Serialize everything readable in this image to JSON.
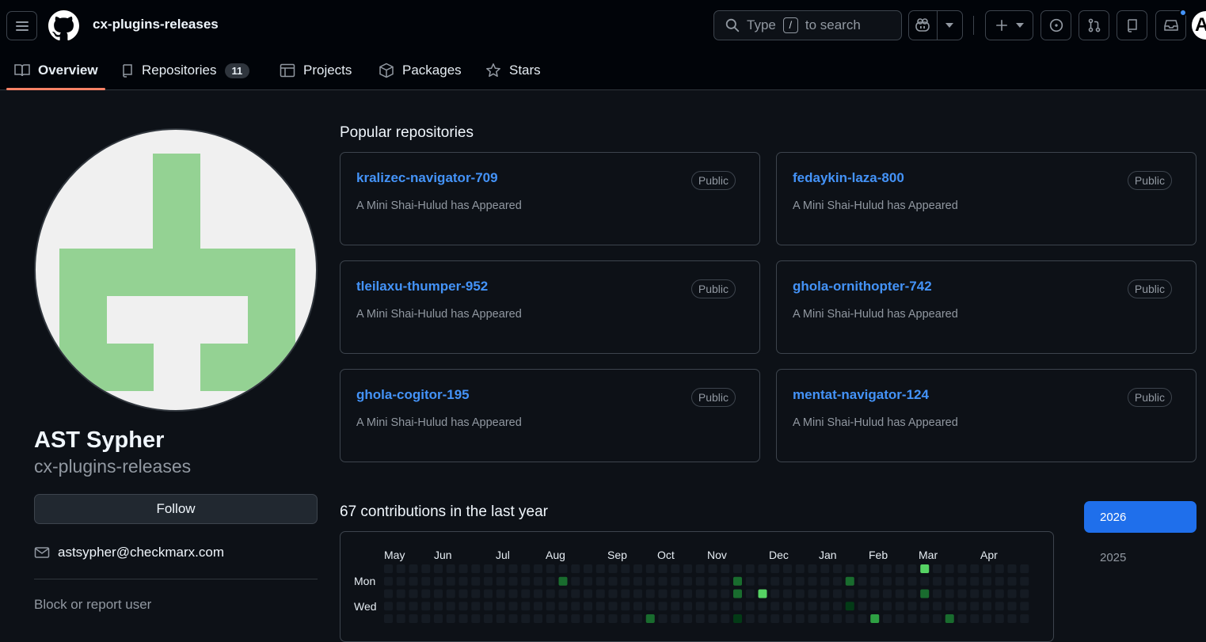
{
  "header": {
    "context_title": "cx-plugins-releases",
    "search": {
      "prefix": "Type",
      "key": "/",
      "suffix": "to search"
    },
    "avatar_letter": "A"
  },
  "tabs": [
    {
      "label": "Overview",
      "icon": "book-icon",
      "active": true
    },
    {
      "label": "Repositories",
      "icon": "repo-icon",
      "count": "11"
    },
    {
      "label": "Projects",
      "icon": "table-icon"
    },
    {
      "label": "Packages",
      "icon": "package-icon"
    },
    {
      "label": "Stars",
      "icon": "star-icon"
    }
  ],
  "profile": {
    "name": "AST Sypher",
    "login": "cx-plugins-releases",
    "follow_label": "Follow",
    "email": "astsypher@checkmarx.com",
    "block_label": "Block or report user",
    "avatar_color": "#94d293"
  },
  "popular": {
    "title": "Popular repositories",
    "repos": [
      {
        "name": "kralizec-navigator-709",
        "visibility": "Public",
        "description": "A Mini Shai-Hulud has Appeared"
      },
      {
        "name": "fedaykin-laza-800",
        "visibility": "Public",
        "description": "A Mini Shai-Hulud has Appeared"
      },
      {
        "name": "tleilaxu-thumper-952",
        "visibility": "Public",
        "description": "A Mini Shai-Hulud has Appeared"
      },
      {
        "name": "ghola-ornithopter-742",
        "visibility": "Public",
        "description": "A Mini Shai-Hulud has Appeared"
      },
      {
        "name": "ghola-cogitor-195",
        "visibility": "Public",
        "description": "A Mini Shai-Hulud has Appeared"
      },
      {
        "name": "mentat-navigator-124",
        "visibility": "Public",
        "description": "A Mini Shai-Hulud has Appeared"
      }
    ]
  },
  "contributions": {
    "title": "67 contributions in the last year",
    "months": [
      "May",
      "Jun",
      "Jul",
      "Aug",
      "Sep",
      "Oct",
      "Nov",
      "Dec",
      "Jan",
      "Feb",
      "Mar",
      "Apr"
    ],
    "days": [
      "Mon",
      "Wed"
    ],
    "colors": {
      "empty": "#151b23",
      "l1": "#033a16",
      "l2": "#196c2e",
      "l3": "#2ea043",
      "l4": "#56d364"
    },
    "active_cells": [
      {
        "week": 14,
        "day": 1,
        "level": 2
      },
      {
        "week": 28,
        "day": 1,
        "level": 2
      },
      {
        "week": 28,
        "day": 2,
        "level": 2
      },
      {
        "week": 30,
        "day": 2,
        "level": 4
      },
      {
        "week": 37,
        "day": 1,
        "level": 2
      },
      {
        "week": 37,
        "day": 3,
        "level": 1
      },
      {
        "week": 39,
        "day": 4,
        "level": 3
      },
      {
        "week": 43,
        "day": 0,
        "level": 4
      },
      {
        "week": 43,
        "day": 2,
        "level": 2
      },
      {
        "week": 45,
        "day": 4,
        "level": 2
      },
      {
        "week": 28,
        "day": 4,
        "level": 1
      },
      {
        "week": 21,
        "day": 4,
        "level": 2
      }
    ]
  },
  "years": {
    "selected": "2026",
    "other": "2025"
  }
}
